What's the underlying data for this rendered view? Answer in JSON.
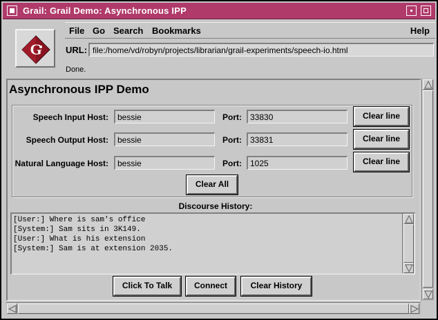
{
  "window": {
    "title": "Grail: Grail Demo: Asynchronous IPP"
  },
  "menu": {
    "items": [
      "File",
      "Go",
      "Search",
      "Bookmarks"
    ],
    "help": "Help"
  },
  "url": {
    "label": "URL:",
    "value": "file:/home/vd/robyn/projects/librarian/grail-experiments/speech-io.html"
  },
  "status": "Done.",
  "page": {
    "title": "Asynchronous IPP Demo",
    "hosts": [
      {
        "label": "Speech Input Host:",
        "host": "bessie",
        "port_label": "Port:",
        "port": "33830",
        "clear": "Clear line"
      },
      {
        "label": "Speech Output Host:",
        "host": "bessie",
        "port_label": "Port:",
        "port": "33831",
        "clear": "Clear line"
      },
      {
        "label": "Natural Language Host:",
        "host": "bessie",
        "port_label": "Port:",
        "port": "1025",
        "clear": "Clear line"
      }
    ],
    "clear_all": "Clear All",
    "history_label": "Discourse History:",
    "history": [
      "[User:] Where is sam's office",
      "[System:] Sam sits in 3K149.",
      "[User:] What is his extension",
      "[System:] Sam is at extension 2035."
    ],
    "buttons": {
      "talk": "Click To Talk",
      "connect": "Connect",
      "clear_history": "Clear History"
    }
  },
  "colors": {
    "titlebar": "#b03a6a",
    "background": "#c8c8c8",
    "logo_red": "#8a1420"
  }
}
